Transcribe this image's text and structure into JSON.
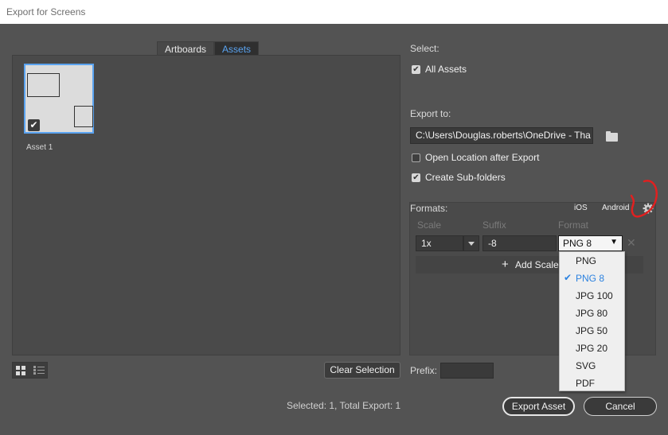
{
  "window": {
    "title": "Export for Screens"
  },
  "tabs": [
    {
      "label": "Artboards"
    },
    {
      "label": "Assets"
    }
  ],
  "assets": [
    {
      "label": "Asset 1",
      "selected": true
    }
  ],
  "left_footer": {
    "clear_selection": "Clear Selection",
    "view_icons": [
      "grid-view-icon",
      "list-view-icon"
    ]
  },
  "select": {
    "label": "Select:",
    "all_assets": {
      "label": "All Assets",
      "checked": true
    }
  },
  "export_to": {
    "label": "Export to:",
    "path": "C:\\Users\\Douglas.roberts\\OneDrive - Tha",
    "folder_icon": "folder-icon",
    "open_location": {
      "label": "Open Location after Export",
      "checked": false
    },
    "create_subfolders": {
      "label": "Create Sub-folders",
      "checked": true
    }
  },
  "formats": {
    "label": "Formats:",
    "ios": "iOS",
    "android": "Android",
    "settings_icon": "gear-icon",
    "col_scale": "Scale",
    "col_suffix": "Suffix",
    "col_format": "Format",
    "row": {
      "scale": "1x",
      "suffix": "-8",
      "format": "PNG 8"
    },
    "add_scale": "Add Scale",
    "dropdown_options": [
      "PNG",
      "PNG 8",
      "JPG 100",
      "JPG 80",
      "JPG 50",
      "JPG 20",
      "SVG",
      "PDF"
    ],
    "dropdown_selected": "PNG 8"
  },
  "prefix": {
    "label": "Prefix:",
    "value": ""
  },
  "status": "Selected: 1, Total Export: 1",
  "buttons": {
    "export": "Export Asset",
    "cancel": "Cancel"
  },
  "colors": {
    "accent": "#5aa3f0",
    "background": "#535353",
    "annotation": "#e02020"
  }
}
